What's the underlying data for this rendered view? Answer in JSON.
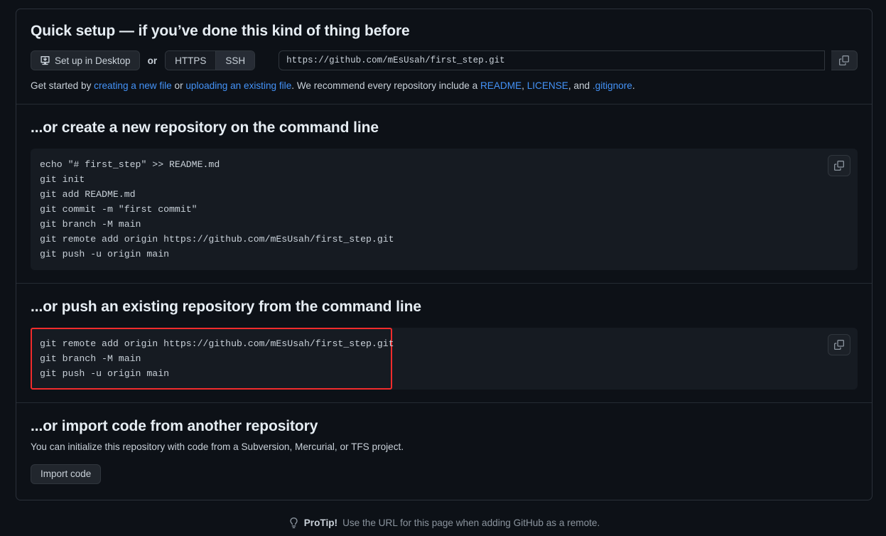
{
  "quick_setup": {
    "heading": "Quick setup — if you’ve done this kind of thing before",
    "desktop_button": "Set up in Desktop",
    "or_label": "or",
    "protocols": [
      {
        "label": "HTTPS",
        "active": false
      },
      {
        "label": "SSH",
        "active": true
      }
    ],
    "repo_url": "https://github.com/mEsUsah/first_step.git",
    "copy_icon": "clipboard-icon",
    "desktop_icon": "desktop-download-icon",
    "hint": {
      "part1": "Get started by ",
      "link1": "creating a new file",
      "part2": " or ",
      "link2": "uploading an existing file",
      "part3": ". We recommend every repository include a ",
      "link3": "README",
      "part4": ", ",
      "link4": "LICENSE",
      "part5": ", and ",
      "link5": ".gitignore",
      "part6": "."
    }
  },
  "create_repo": {
    "heading": "...or create a new repository on the command line",
    "copy_icon": "clipboard-icon",
    "lines": [
      "echo \"# first_step\" >> README.md",
      "git init",
      "git add README.md",
      "git commit -m \"first commit\"",
      "git branch -M main",
      "git remote add origin https://github.com/mEsUsah/first_step.git",
      "git push -u origin main"
    ]
  },
  "push_repo": {
    "heading": "...or push an existing repository from the command line",
    "copy_icon": "clipboard-icon",
    "highlight_color": "#f22c2c",
    "lines": [
      "git remote add origin https://github.com/mEsUsah/first_step.git",
      "git branch -M main",
      "git push -u origin main"
    ]
  },
  "import_repo": {
    "heading": "...or import code from another repository",
    "description": "You can initialize this repository with code from a Subversion, Mercurial, or TFS project.",
    "button": "Import code"
  },
  "footer": {
    "icon": "lightbulb-icon",
    "label": "ProTip!",
    "text": "Use the URL for this page when adding GitHub as a remote."
  },
  "colors": {
    "background": "#0d1117",
    "border": "#2b313a",
    "code_background": "#161b22",
    "link": "#4493f8",
    "text": "#c9d1d9",
    "heading": "#e6edf3",
    "muted": "#8b949e",
    "highlight": "#f22c2c"
  }
}
